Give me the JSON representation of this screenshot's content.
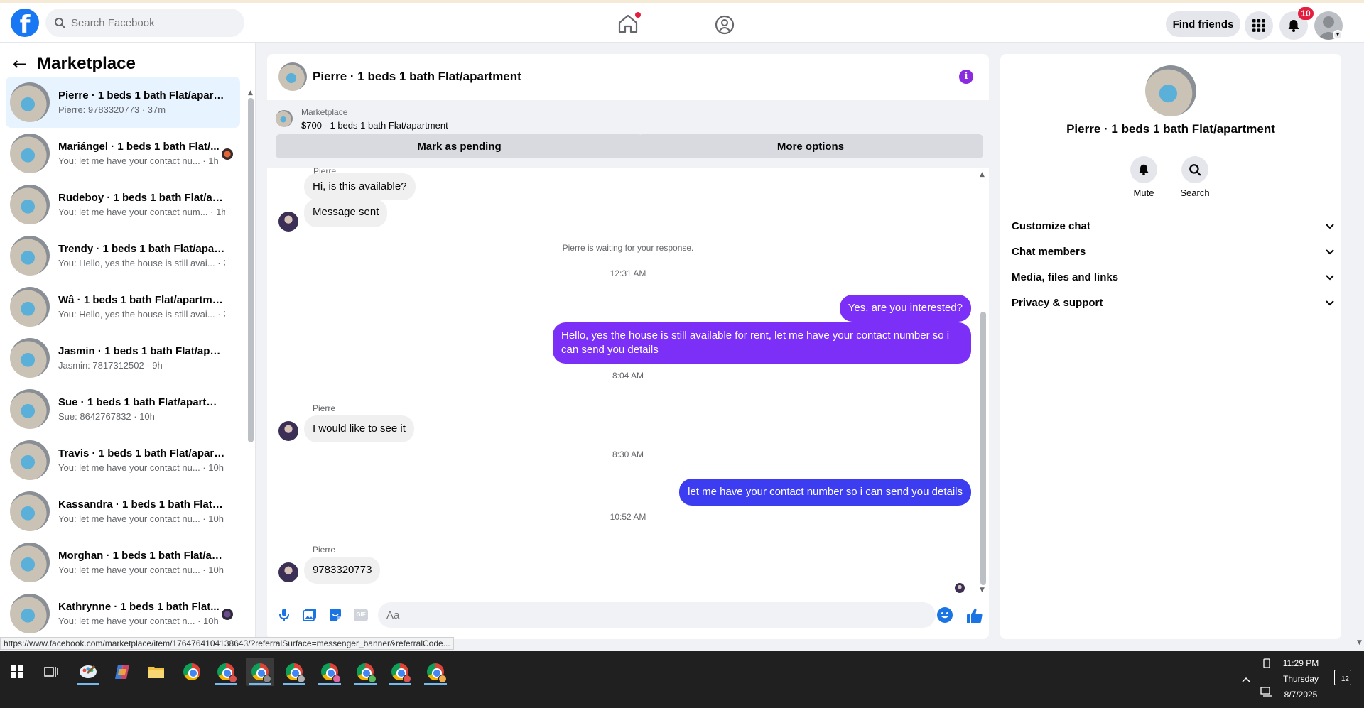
{
  "topbar": {
    "logo_letter": "f",
    "search_placeholder": "Search Facebook",
    "find_friends_label": "Find friends",
    "notification_count": "10"
  },
  "sidebar": {
    "back_label": "←",
    "title": "Marketplace",
    "conversations": [
      {
        "name": "Pierre · 1 beds 1 bath Flat/apart...",
        "preview": "Pierre: 9783320773 · 37m",
        "active": true
      },
      {
        "name": "Mariángel · 1 beds 1 bath Flat/...",
        "preview": "You: let me have your contact nu... · 1h"
      },
      {
        "name": "Rudeboy · 1 beds 1 bath Flat/apa...",
        "preview": "You: let me have your contact num... · 1h"
      },
      {
        "name": "Trendy · 1 beds 1 bath Flat/apart...",
        "preview": "You: Hello, yes the house is still avai... · 2h"
      },
      {
        "name": "Wâ · 1 beds 1 bath Flat/apartment",
        "preview": "You: Hello, yes the house is still avai... · 2h"
      },
      {
        "name": "Jasmin · 1 beds 1 bath Flat/apart...",
        "preview": "Jasmin: 7817312502 · 9h"
      },
      {
        "name": "Sue · 1 beds 1 bath Flat/apartment",
        "preview": "Sue: 8642767832 · 10h"
      },
      {
        "name": "Travis · 1 beds 1 bath Flat/apart...",
        "preview": "You: let me have your contact nu... · 10h"
      },
      {
        "name": "Kassandra · 1 beds 1 bath Flat/ap...",
        "preview": "You: let me have your contact nu... · 10h"
      },
      {
        "name": "Morghan · 1 beds 1 bath Flat/ap...",
        "preview": "You: let me have your contact nu... · 10h"
      },
      {
        "name": "Kathrynne · 1 beds 1 bath Flat...",
        "preview": "You: let me have your contact n... · 10h"
      }
    ]
  },
  "chat": {
    "title": "Pierre · 1 beds 1 bath Flat/apartment",
    "info_glyph": "i",
    "listing": {
      "category": "Marketplace",
      "price_title": "$700 - 1 beds 1 bath Flat/apartment",
      "mark_pending_label": "Mark as pending",
      "more_options_label": "More options"
    },
    "sender_name": "Pierre",
    "messages": {
      "m1": "Hi, is this available?",
      "m2": "Message sent",
      "waiting_note": "Pierre is waiting for your response.",
      "ts1": "12:31 AM",
      "m3": "Yes, are you interested?",
      "m4": "Hello, yes the house is still available for rent, let me have your contact number so i can send you details",
      "ts2": "8:04 AM",
      "m5": "I would like to see it",
      "ts3": "8:30 AM",
      "m6": "let me have your contact number so i can send you details",
      "ts4": "10:52 AM",
      "m7": "9783320773"
    },
    "composer_placeholder": "Aa",
    "gif_label": "GIF"
  },
  "details": {
    "title": "Pierre · 1 beds 1 bath Flat/apartment",
    "mute_label": "Mute",
    "search_label": "Search",
    "sections": [
      "Customize chat",
      "Chat members",
      "Media, files and links",
      "Privacy & support"
    ]
  },
  "status_bar": {
    "url": "https://www.facebook.com/marketplace/item/1764764104138643/?referralSurface=messenger_banner&referralCode..."
  },
  "taskbar": {
    "time": "11:29 PM",
    "day": "Thursday",
    "date": "8/7/2025",
    "notif_count": "12"
  },
  "colors": {
    "brand": "#1877f2",
    "outgoing_bubble": "#7b2ff7",
    "outgoing_bubble_alt": "#3c3cf0",
    "badge": "#e41e3f"
  }
}
